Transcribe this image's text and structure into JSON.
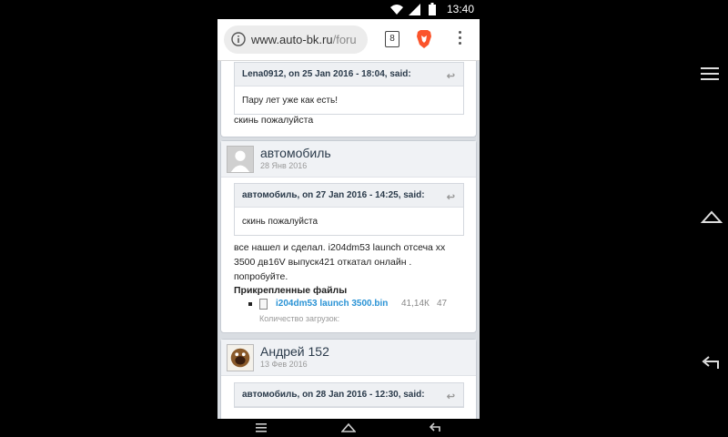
{
  "status_bar": {
    "time": "13:40"
  },
  "browser": {
    "url_main": "www.auto-bk.ru",
    "url_rest": "/foru",
    "tab_count": "8"
  },
  "posts": [
    {
      "quote": {
        "header": "Lena0912, on 25 Jan 2016 - 18:04, said:",
        "body": "Пару лет уже как есть!"
      },
      "text": "скинь пожалуйста"
    },
    {
      "author": "автомобиль",
      "date": "28 Янв 2016",
      "quote": {
        "header": "автомобиль, on 27 Jan 2016 - 14:25, said:",
        "body": "скинь пожалуйста"
      },
      "text_lines": [
        "все нашел и сделал. i204dm53 launch отсеча хх",
        "3500 дв16V выпуск421 откатал онлайн .",
        "попробуйте."
      ],
      "attachments_title": "Прикрепленные файлы",
      "attachment": {
        "name": "i204dm53 launch 3500.bin",
        "size": "41,14К",
        "count": "47"
      },
      "download_label": "Количество загрузок:"
    },
    {
      "author": "Андрей 152",
      "date": "13 Фев 2016",
      "quote": {
        "header": "автомобиль, on 28 Jan 2016 - 12:30, said:"
      }
    }
  ],
  "icons": {
    "quote_arrow": "↩",
    "wifi": "wifi-icon",
    "signal": "signal-icon",
    "battery": "battery-icon",
    "info": "info-icon",
    "brave": "brave-lion-icon",
    "menu": "more-vert-icon",
    "recents": "recents-icon",
    "home": "home-icon",
    "back": "back-icon"
  },
  "colors": {
    "link": "#2a93d5",
    "brave": "#fb542b"
  }
}
